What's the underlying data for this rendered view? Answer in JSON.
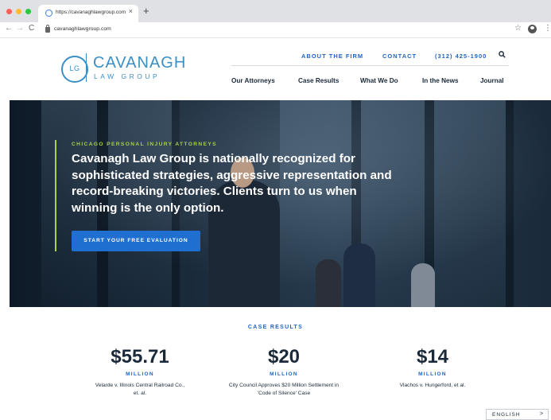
{
  "browser": {
    "tab_title": "https://cavanaghlawgroup.com",
    "tab_close": "×",
    "new_tab": "+",
    "back": "←",
    "forward": "→",
    "reload": "C",
    "url": "cavanaghlawgroup.com",
    "star": "☆",
    "menu": "⋮"
  },
  "logo": {
    "monogram": "LG",
    "name": "CAVANAGH",
    "subtitle": "LAW GROUP"
  },
  "top_nav": {
    "about": "ABOUT THE FIRM",
    "contact": "CONTACT",
    "phone": "(312) 425-1900"
  },
  "main_nav": [
    "Our Attorneys",
    "Case Results",
    "What We Do",
    "In the News",
    "Journal"
  ],
  "hero": {
    "eyebrow": "CHICAGO PERSONAL INJURY ATTORNEYS",
    "headline": "Cavanagh Law Group is nationally recognized for sophisticated strategies, aggressive representation and record-breaking victories. Clients turn to us when winning is the only option.",
    "cta": "START YOUR FREE EVALUATION"
  },
  "case_results": {
    "label": "CASE RESULTS",
    "items": [
      {
        "amount": "$55.71",
        "unit": "MILLION",
        "description": "Velarde v. Illinois Central Railroad Co., et. al."
      },
      {
        "amount": "$20",
        "unit": "MILLION",
        "description": "City Council Approves $20 Million Settlement in 'Code of Silence' Case"
      },
      {
        "amount": "$14",
        "unit": "MILLION",
        "description": "Vlachos v. Hungerford, et al."
      }
    ]
  },
  "language": {
    "label": "ENGLISH",
    "arrow": ">"
  },
  "colors": {
    "accent_blue": "#1f64c4",
    "logo_blue": "#3b8fc4",
    "hero_accent": "#a8d146",
    "cta_blue": "#1f6fd1"
  }
}
